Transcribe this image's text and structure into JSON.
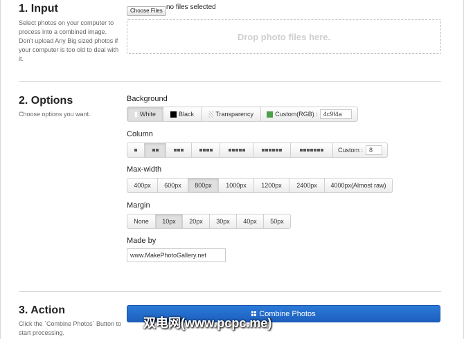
{
  "input": {
    "title": "1. Input",
    "description": "Select photos on your computer to process into a combined image. Don't upload Any Big sized photos if your computer is too old to deal with it.",
    "choose_files_label": "Choose Files",
    "file_status": "no files selected",
    "dropzone_text": "Drop photo files here."
  },
  "options": {
    "title": "2. Options",
    "description": "Choose options you want.",
    "background": {
      "label": "Background",
      "options": [
        "White",
        "Black",
        "Transparency",
        "Custom(RGB) :"
      ],
      "custom_value": "4c9f4a",
      "selected": "White"
    },
    "column": {
      "label": "Column",
      "options": [
        1,
        2,
        3,
        4,
        5,
        6,
        7
      ],
      "selected": 2,
      "custom_label": "Custom :",
      "custom_value": "8"
    },
    "max_width": {
      "label": "Max-width",
      "options": [
        "400px",
        "600px",
        "800px",
        "1000px",
        "1200px",
        "2400px",
        "4000px(Almost raw)"
      ],
      "selected": "800px"
    },
    "margin": {
      "label": "Margin",
      "options": [
        "None",
        "10px",
        "20px",
        "30px",
        "40px",
        "50px"
      ],
      "selected": "10px"
    },
    "made_by": {
      "label": "Made by",
      "value": "www.MakePhotoGallery.net"
    }
  },
  "action": {
    "title": "3. Action",
    "description": "Click the `Combine Photos` Button to start processing.",
    "combine_label": "Combine Photos"
  },
  "watermark": "双电网(www.pcpc.me)",
  "colors": {
    "accent": "#1d6fd1",
    "custom_swatch": "#4c9f4a"
  }
}
